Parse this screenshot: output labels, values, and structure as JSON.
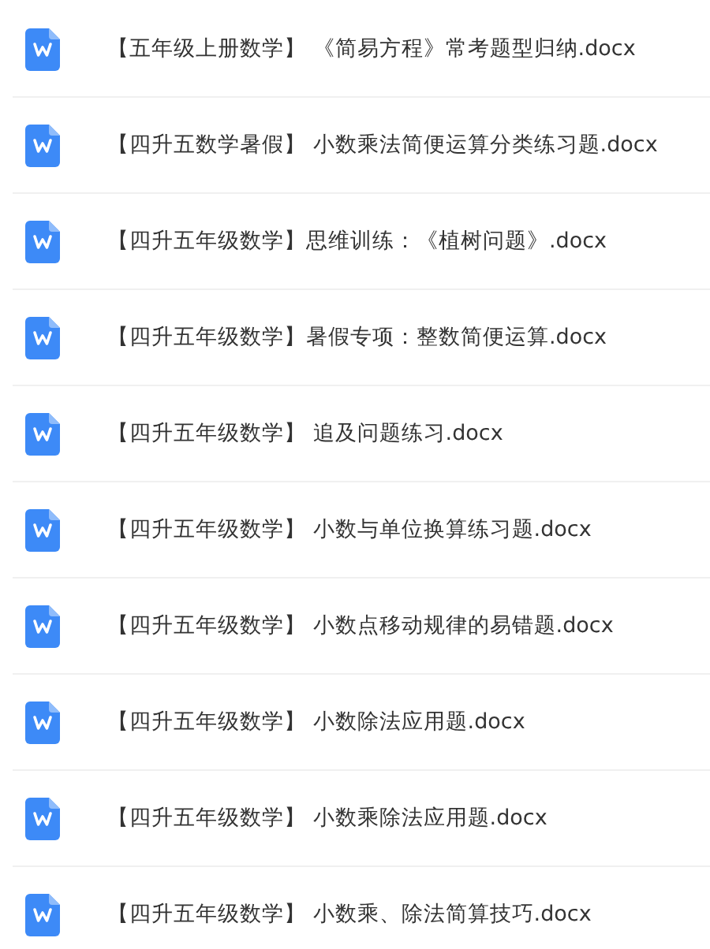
{
  "files": [
    {
      "name": "【五年级上册数学】 《简易方程》常考题型归纳.docx"
    },
    {
      "name": "【四升五数学暑假】 小数乘法简便运算分类练习题.docx"
    },
    {
      "name": "【四升五年级数学】思维训练：《植树问题》.docx"
    },
    {
      "name": "【四升五年级数学】暑假专项：整数简便运算.docx"
    },
    {
      "name": "【四升五年级数学】 追及问题练习.docx"
    },
    {
      "name": "【四升五年级数学】 小数与单位换算练习题.docx"
    },
    {
      "name": "【四升五年级数学】 小数点移动规律的易错题.docx"
    },
    {
      "name": "【四升五年级数学】 小数除法应用题.docx"
    },
    {
      "name": "【四升五年级数学】 小数乘除法应用题.docx"
    },
    {
      "name": "【四升五年级数学】 小数乘、除法简算技巧.docx"
    }
  ]
}
